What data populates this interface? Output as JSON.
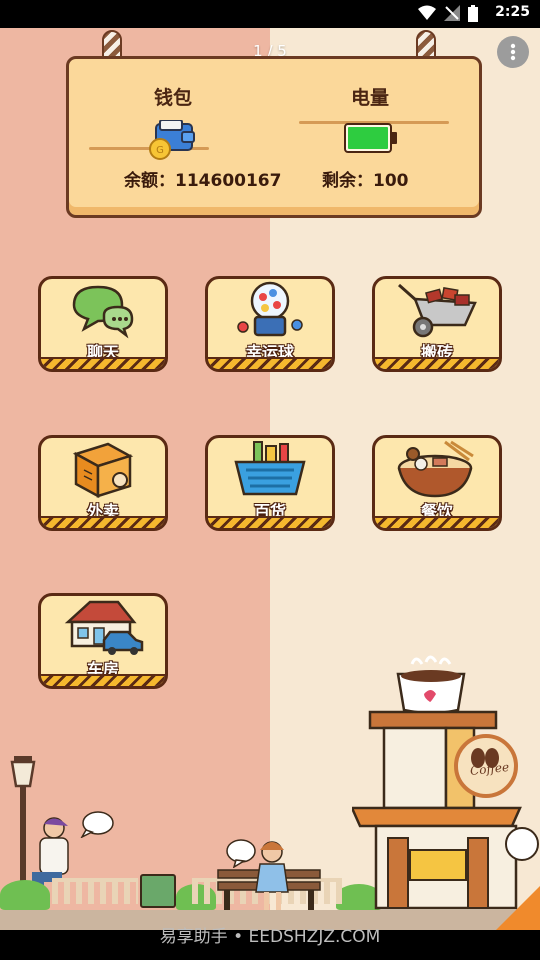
{
  "status_bar": {
    "time": "2:25"
  },
  "pager": {
    "indicator": "1 / 5"
  },
  "sign": {
    "wallet_title": "钱包",
    "battery_title": "电量",
    "balance_text": "余额：114600167",
    "remaining_text": "剩余：100",
    "battery_level_percent": 100
  },
  "apps": [
    {
      "label": "聊天",
      "icon": "chat-bubbles-icon"
    },
    {
      "label": "幸运球",
      "icon": "gumball-machine-icon"
    },
    {
      "label": "搬砖",
      "icon": "wheelbarrow-bricks-icon"
    },
    {
      "label": "外卖",
      "icon": "delivery-box-icon"
    },
    {
      "label": "百货",
      "icon": "shopping-basket-icon"
    },
    {
      "label": "餐饮",
      "icon": "noodle-bowl-icon"
    },
    {
      "label": "车房",
      "icon": "house-car-icon"
    }
  ],
  "scene": {
    "cafe_sign": "Coffee"
  },
  "watermark": {
    "text": "易享助手 • EEDSHZJZ.COM"
  },
  "colors": {
    "background_left": "#eeb7a2",
    "background_right": "#f7e8d3",
    "board": "#fbd89a",
    "tile": "#fde7ad",
    "outline": "#5a2a14",
    "battery_green": "#2ecc40"
  }
}
